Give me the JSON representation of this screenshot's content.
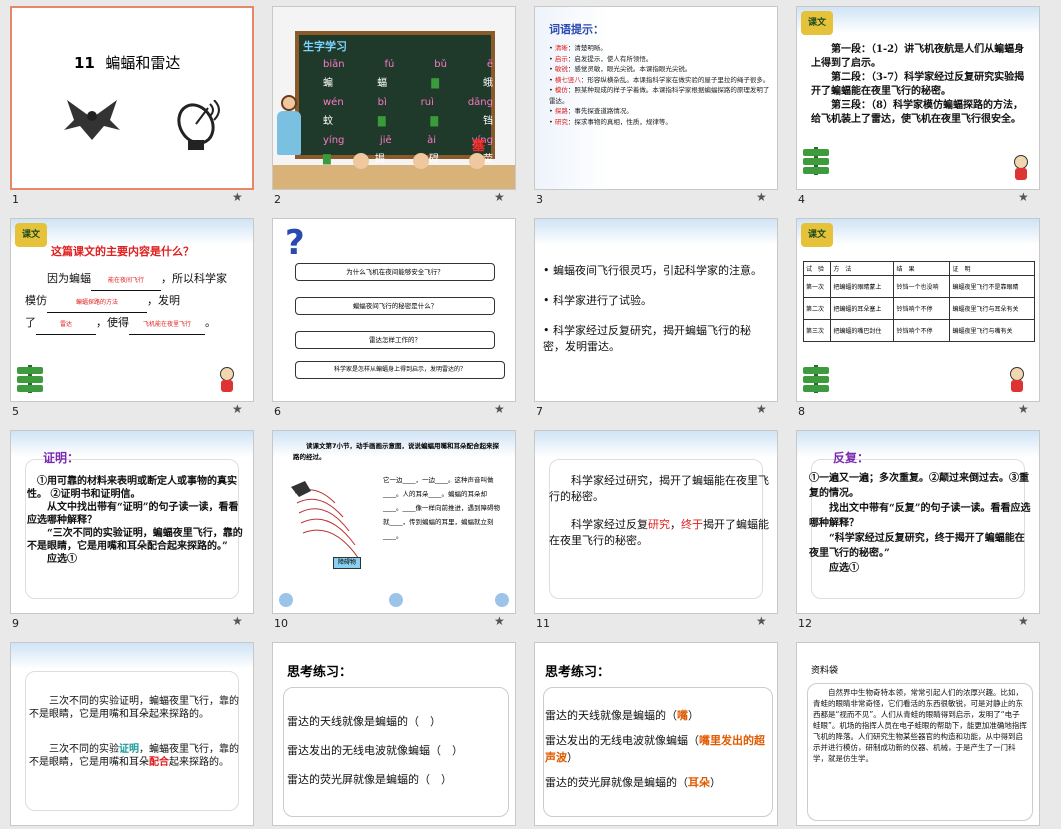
{
  "slides": [
    {
      "num": "1",
      "title_num": "11",
      "title": "蝙蝠和雷达"
    },
    {
      "num": "2",
      "header": "生字学习",
      "pinyin_rows": [
        [
          "biān",
          "fú",
          "bǔ",
          "ē"
        ],
        [
          "wén",
          "bì",
          "ruì",
          "dāng"
        ],
        [
          "yíng",
          "jiē",
          "ài",
          "yíng"
        ]
      ],
      "char_rows": [
        [
          "蝙",
          "蝠",
          "",
          "蛾"
        ],
        [
          "蚊",
          "",
          "",
          "铛"
        ],
        [
          "",
          "揭",
          "碍",
          "荧"
        ]
      ],
      "extra_char": "塞"
    },
    {
      "num": "3",
      "header": "词语提示：",
      "items": [
        {
          "word": "清晰",
          "text": "：清楚明晰。"
        },
        {
          "word": "启示",
          "text": "：启发提示，使人有所领悟。"
        },
        {
          "word": "敏锐",
          "text": "：感觉灵敏，眼光尖锐。本课指眼光尖锐。"
        },
        {
          "word": "横七竖八",
          "text": "：形容纵横杂乱。本课指科学家在做实验的屋子里拉的绳子很多。"
        },
        {
          "word": "模仿",
          "text": "：照某种现成的样子学着做。本课指科学家根据蝙蝠探路的原理发明了雷达。"
        },
        {
          "word": "探路",
          "text": "：事先探查道路情况。"
        },
        {
          "word": "研究",
          "text": "：探求事物的真相，性质，规律等。"
        }
      ]
    },
    {
      "num": "4",
      "paras": [
        "第一段：（1-2）讲飞机夜航是人们从蝙蝠身上得到了启示。",
        "第二段：（3-7）科学家经过反复研究实验揭开了蝙蝠能在夜里飞行的秘密。",
        "第三段：（8）科学家模仿蝙蝠探路的方法，给飞机装上了雷达，使飞机在夜里飞行很安全。"
      ]
    },
    {
      "num": "5",
      "question": "这篇课文的主要内容是什么？",
      "line1": "因为蝙蝠",
      "fill1": "能在夜间飞行",
      "line1b": "，所以科学家",
      "line2": "模仿",
      "fill2": "蝙蝠探路的方法",
      "line2b": "，发明",
      "line3": "了",
      "fill3": "雷达",
      "line3b": "，使得",
      "fill4": "飞机能在夜里飞行",
      "line3c": "。"
    },
    {
      "num": "6",
      "questions": [
        "为什么飞机在夜间能够安全飞行？",
        "蝙蝠夜间飞行的秘密是什么？",
        "雷达怎样工作的？",
        "科学家是怎样从蝙蝠身上得到启示，发明雷达的？"
      ]
    },
    {
      "num": "7",
      "bullets": [
        "蝙蝠夜间飞行很灵巧，引起科学家的注意。",
        "科学家进行了试验。",
        "科学家经过反复研究，揭开蝙蝠飞行的秘密，发明雷达。"
      ]
    },
    {
      "num": "8",
      "headers": [
        "试　验",
        "方　法",
        "结　果",
        "证　明"
      ],
      "rows": [
        [
          "第一次",
          "把蝙蝠的眼睛蒙上",
          "铃铛一个也没响",
          "蝙蝠夜里飞行不是靠眼睛"
        ],
        [
          "第二次",
          "把蝙蝠的耳朵塞上",
          "铃铛响个不停",
          "蝙蝠夜里飞行与耳朵有关"
        ],
        [
          "第三次",
          "把蝙蝠的嘴巴封住",
          "铃铛响个不停",
          "蝙蝠夜里飞行与嘴有关"
        ]
      ]
    },
    {
      "num": "9",
      "title": "证明：",
      "p1": "①用可靠的材料来表明或断定人或事物的真实性。 ②证明书和证明信。",
      "p2": "从文中找出带有“证明”的句子读一读，看看应选哪种解释？",
      "p3": "“三次不同的实验证明，蝙蝠夜里飞行，靠的不是眼睛，它是用嘴和耳朵配合起来探路的。”",
      "p4": "应选①"
    },
    {
      "num": "10",
      "instr": "读课文第7小节，动手画画示意图，说说蝙蝠用嘴和耳朵配合起来探路的经过。",
      "blanks": "它一边____，一边____。这种声音叫做____。人的耳朵____。蝙蝠的耳朵却____。____像一样向前推进，遇到障碍物就____，传到蝙蝠的耳里，蝙蝠就立刻____。",
      "label": "障碍物"
    },
    {
      "num": "11",
      "p1": "科学家经过研究，揭开了蝙蝠能在夜里飞行的秘密。",
      "p2a": "科学家经过反复",
      "p2b": "研究",
      "p2c": "，",
      "p2d": "终于",
      "p2e": "揭开了蝙蝠能在夜里飞行的秘密。"
    },
    {
      "num": "12",
      "title": "反复：",
      "p1": "①一遍又一遍；多次重复。②颠过来倒过去。③重复的情况。",
      "p2": "找出文中带有“反复”的句子读一读。看看应选哪种解释？",
      "p3": "“科学家经过反复研究，终于揭开了蝙蝠能在夜里飞行的秘密。”",
      "p4": "应选①"
    },
    {
      "num": "13",
      "p1": "三次不同的实验证明，蝙蝠夜里飞行，靠的不是眼睛，它是用嘴和耳朵起来探路的。",
      "p2a": "三次不同的实验",
      "p2b": "证明",
      "p2c": "，蝙蝠夜里飞行，靠的不是眼睛，它是用嘴和耳朵",
      "p2d": "配合",
      "p2e": "起来探路的。"
    },
    {
      "num": "14",
      "title": "思考练习：",
      "lines": [
        "雷达的天线就像是蝙蝠的（　）",
        "雷达发出的无线电波就像蝙蝠（　）",
        "雷达的荧光屏就像是蝙蝠的（　）"
      ]
    },
    {
      "num": "15",
      "title": "思考练习：",
      "l1a": "雷达的天线就像是蝙蝠的（",
      "l1b": "嘴",
      "l1c": "）",
      "l2a": "雷达发出的无线电波就像蝙蝠（",
      "l2b": "嘴里发出的超声波",
      "l2c": "）",
      "l3a": "雷达的荧光屏就像是蝙蝠的（",
      "l3b": "耳朵",
      "l3c": "）"
    },
    {
      "num": "16",
      "title": "资料袋",
      "text": "自然界中生物奇特本领，常常引起人们的浓厚兴趣。比如，青蛙的眼睛非常奇怪，它们看活的东西很敏锐，可是对静止的东西都是“视而不见”。人们从青蛙的眼睛得到启示，发明了“电子蛙眼”。机场的指挥人员在电子蛙眼的帮助下，能更加准确地指挥飞机的降落。人们研究生物某些器官的构造和功能，从中得到启示并进行模仿，研制成功新的仪器、机械，于是产生了一门科学，就是仿生学。"
    }
  ],
  "star_icon": "★"
}
